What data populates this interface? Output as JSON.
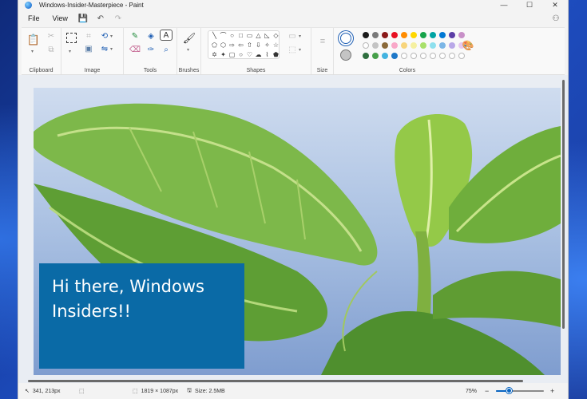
{
  "window": {
    "title": "Windows-Insider-Masterpiece - Paint",
    "controls": {
      "minimize": "—",
      "maximize": "☐",
      "close": "✕"
    }
  },
  "menubar": {
    "file": "File",
    "view": "View",
    "save_icon": "💾",
    "undo_icon": "↶",
    "redo_icon": "↷",
    "share_icon": "⚇"
  },
  "ribbon": {
    "groups": {
      "clipboard": "Clipboard",
      "image": "Image",
      "tools": "Tools",
      "brushes": "Brushes",
      "shapes": "Shapes",
      "size": "Size",
      "colors": "Colors"
    },
    "shape_glyphs": [
      "╲",
      "⌒",
      "○",
      "□",
      "▭",
      "△",
      "◺",
      "◇",
      "⬠",
      "⬡",
      "⇨",
      "⇦",
      "⇧",
      "⇩",
      "✧",
      "☆",
      "✡",
      "✦",
      "▢",
      "○",
      "♡",
      "☁",
      "⌇",
      "⬟"
    ],
    "primary_color": "#ffffff",
    "secondary_color": "#c4c4c4",
    "palette": [
      [
        "#1b1b1b",
        "#7a7a7a",
        "#8b1a1a",
        "#e81123",
        "#ff8c00",
        "#ffd700",
        "#16a34a",
        "#00a3a3",
        "#0078d4",
        "#5c3ea6",
        "#c890c8"
      ],
      [
        "#ffffff",
        "#c4c4c4",
        "#8b6a3a",
        "#f9a8c8",
        "#f8d57c",
        "#f5f0a0",
        "#a8e06a",
        "#8ee0ee",
        "#7bb6e6",
        "#b9a8e8",
        "#e7c8f0"
      ],
      [
        "#2f6f3f",
        "#47a04a",
        "#43b3e0",
        "#1e78c8",
        "#ffffff",
        "#ffffff",
        "#ffffff",
        "#ffffff",
        "#ffffff",
        "#ffffff",
        "#ffffff"
      ]
    ],
    "edit_colors_icon": "🎨"
  },
  "canvas": {
    "text_box_text": "Hi there, Windows Insiders!!"
  },
  "statusbar": {
    "cursor_pos": "341, 213px",
    "canvas_size": "1819 × 1087px",
    "file_size": "Size: 2.5MB",
    "zoom": "75%",
    "zoom_fraction": 0.28
  }
}
